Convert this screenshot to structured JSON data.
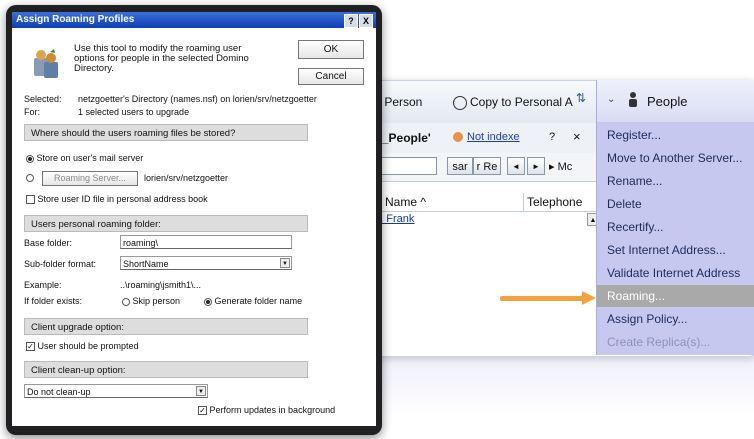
{
  "dialog": {
    "title": "Assign Roaming Profiles",
    "help_btn": "?",
    "close_btn": "X",
    "intro": "Use this tool to modify the roaming user options for people in the selected Domino Directory.",
    "ok_label": "OK",
    "cancel_label": "Cancel",
    "selected_label": "Selected:",
    "selected_value": "netzgoetter's Directory (names.nsf) on lorien/srv/netzgoetter",
    "for_label": "For:",
    "for_value": "1 selected users to upgrade",
    "section_files": "Where should the users roaming files be stored?",
    "opt_mail_server": "Store on user's mail server",
    "roaming_server_btn": "Roaming Server...",
    "roaming_server_value": "lorien/srv/netzgoetter",
    "opt_store_id": "Store user ID file in personal address book",
    "section_folder": "Users personal roaming folder:",
    "base_folder_label": "Base folder:",
    "base_folder_value": "roaming\\",
    "subfolder_label": "Sub-folder format:",
    "subfolder_value": "ShortName",
    "example_label": "Example:",
    "example_value": "..\\roaming\\jsmith1\\...",
    "if_exists_label": "If folder exists:",
    "opt_skip": "Skip person",
    "opt_generate": "Generate folder name",
    "section_upgrade": "Client upgrade option:",
    "opt_prompted": "User should be prompted",
    "section_cleanup": "Client clean-up option:",
    "cleanup_value": "Do not clean-up",
    "opt_background": "Perform updates in background"
  },
  "background_window": {
    "toolbar_person": "it Person",
    "toolbar_copy": "Copy to Personal A",
    "view_title": "'_People'",
    "not_indexed": "Not indexe",
    "help": "?",
    "close": "×",
    "search_btn": "sar",
    "refine_btn": "r Re",
    "nav_prev": "◄",
    "nav_next": "►",
    "more": "▸ Mc",
    "col_name": "Name ^",
    "col_phone": "Telephone",
    "row1": "g., Frank",
    "row1_mark": "▲"
  },
  "menu": {
    "header": "People",
    "items": [
      "Register...",
      "Move to Another Server...",
      "Rename...",
      "Delete",
      "Recertify...",
      "Set Internet Address...",
      "Validate Internet Address",
      "Roaming...",
      "Assign Policy...",
      "Create Replica(s)..."
    ],
    "selected_index": 7
  },
  "colors": {
    "menu_bg": "#c6c8ef",
    "arrow": "#f2a340",
    "titlebar": "#0b3fb3"
  }
}
